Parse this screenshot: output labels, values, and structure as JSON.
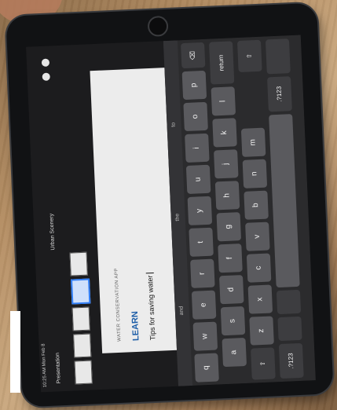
{
  "app": {
    "status_time": "10:25 AM  Mon Feb 8",
    "doc_title": "Presentation",
    "center_title": "Urban Scenery"
  },
  "slide": {
    "caption": "WATER CONSERVATION APP",
    "heading": "LEARN",
    "textbox": "Tips for saving water"
  },
  "predictions": [
    "and",
    "the",
    "to"
  ],
  "keyboard": {
    "row1": [
      "q",
      "w",
      "e",
      "r",
      "t",
      "y",
      "u",
      "i",
      "o",
      "p"
    ],
    "row2": [
      "a",
      "s",
      "d",
      "f",
      "g",
      "h",
      "j",
      "k",
      "l"
    ],
    "row3": [
      "z",
      "x",
      "c",
      "v",
      "b",
      "n",
      "m"
    ],
    "labels": {
      "return": "return",
      "numbers": ".?123",
      "delete": "⌫",
      "shift": "⇧"
    }
  },
  "colors": {
    "accent": "#2f7df6",
    "heading": "#1f5fa8"
  }
}
